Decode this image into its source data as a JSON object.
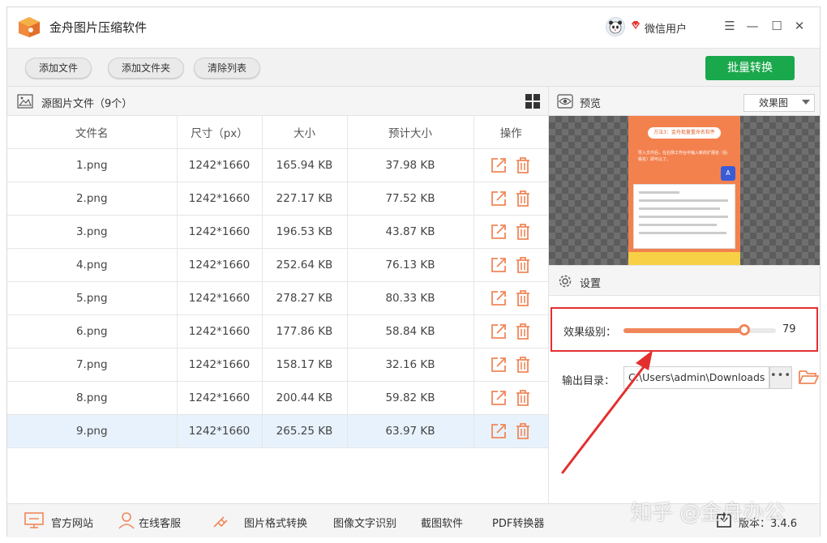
{
  "app": {
    "title": "金舟图片压缩软件"
  },
  "user": {
    "name": "微信用户"
  },
  "window_controls": {
    "menu": "☰",
    "minimize": "—",
    "maximize": "☐",
    "close": "✕"
  },
  "toolbar": {
    "add_file": "添加文件",
    "add_folder": "添加文件夹",
    "clear_list": "清除列表",
    "batch_convert": "批量转换"
  },
  "files_panel": {
    "title": "源图片文件（9个）",
    "columns": [
      "文件名",
      "尺寸（px）",
      "大小",
      "预计大小",
      "操作"
    ],
    "rows": [
      {
        "name": "1.png",
        "dimensions": "1242*1660",
        "size": "165.94 KB",
        "estimated": "37.98 KB"
      },
      {
        "name": "2.png",
        "dimensions": "1242*1660",
        "size": "227.17 KB",
        "estimated": "77.52 KB"
      },
      {
        "name": "3.png",
        "dimensions": "1242*1660",
        "size": "196.53 KB",
        "estimated": "43.87 KB"
      },
      {
        "name": "4.png",
        "dimensions": "1242*1660",
        "size": "252.64 KB",
        "estimated": "76.13 KB"
      },
      {
        "name": "5.png",
        "dimensions": "1242*1660",
        "size": "278.27 KB",
        "estimated": "80.33 KB"
      },
      {
        "name": "6.png",
        "dimensions": "1242*1660",
        "size": "177.86 KB",
        "estimated": "58.84 KB"
      },
      {
        "name": "7.png",
        "dimensions": "1242*1660",
        "size": "158.17 KB",
        "estimated": "32.16 KB"
      },
      {
        "name": "8.png",
        "dimensions": "1242*1660",
        "size": "200.44 KB",
        "estimated": "59.82 KB"
      },
      {
        "name": "9.png",
        "dimensions": "1242*1660",
        "size": "265.25 KB",
        "estimated": "63.97 KB"
      }
    ],
    "selected_row": 8
  },
  "preview": {
    "title": "预览",
    "view_mode": "效果图",
    "card_title": "方法3：金舟批量重命名软件",
    "card_text": "导入文件后，在右侧工作台中输入新的扩展名（后缀名）即可以了。",
    "card_badge": "A"
  },
  "settings": {
    "title": "设置",
    "level_label": "效果级别：",
    "level_value": 79,
    "level_value_text": "79",
    "output_label": "输出目录：",
    "output_path": "C:\\Users\\admin\\Downloads",
    "more_label": "•••"
  },
  "footer": {
    "official_site": "官方网站",
    "online_service": "在线客服",
    "format_convert": "图片格式转换",
    "ocr": "图像文字识别",
    "screenshot": "截图软件",
    "pdf": "PDF转换器",
    "version": "版本：3.4.6"
  },
  "watermark": "知乎 @金舟办公",
  "colors": {
    "accent_green": "#1aa84c",
    "icon_orange": "#f0875a",
    "annotation_red": "#e42f2f",
    "selected_row": "#e8f2fc"
  }
}
